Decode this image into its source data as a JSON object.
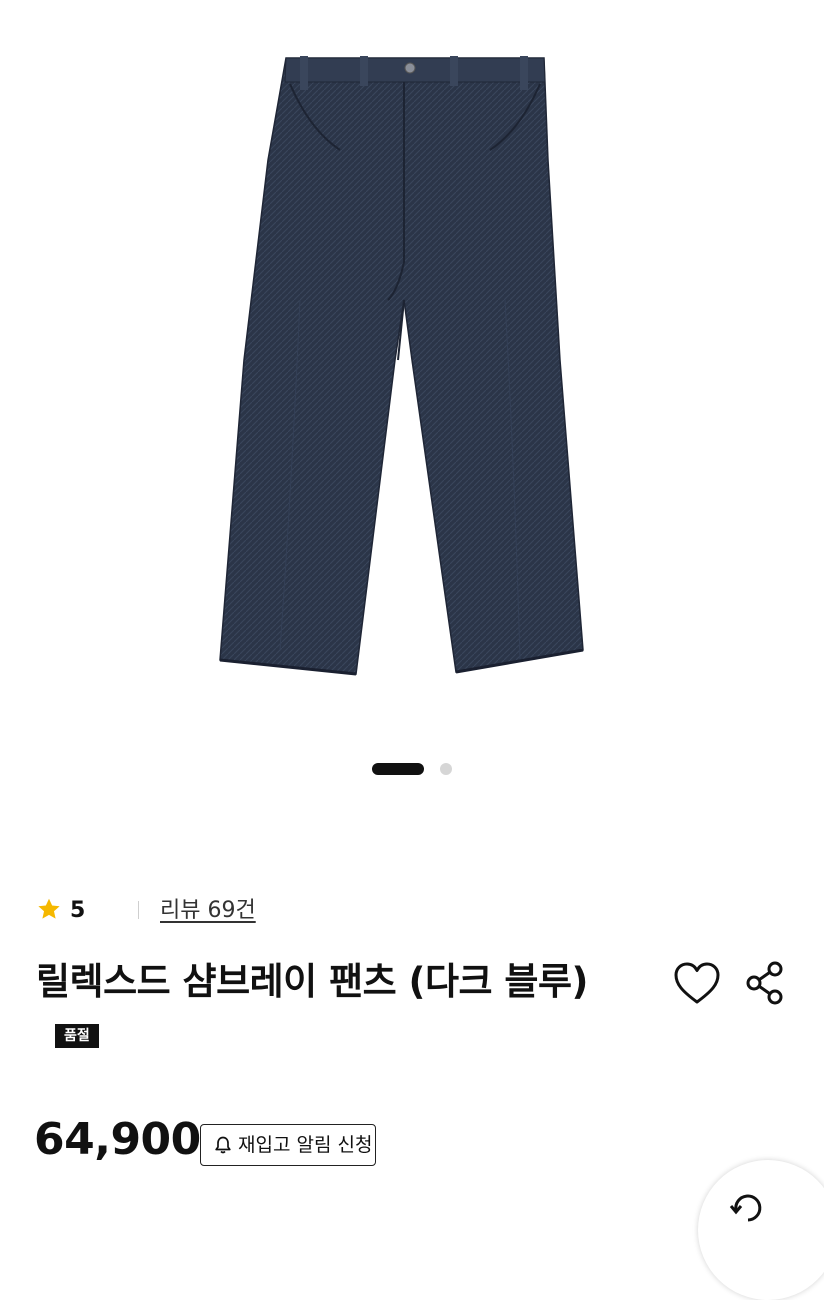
{
  "product": {
    "image_icon": "wide-leg-dark-blue-denim-pants",
    "carousel": {
      "count": 2,
      "active_index": 0
    },
    "rating": {
      "star_icon": "star-icon",
      "star_color": "#F5B800",
      "value": "5"
    },
    "review_link": "리뷰 69건",
    "title": "릴렉스드 샴브레이 팬츠 (다크 블루)",
    "badge": "품절",
    "price": "64,900",
    "restock_button": {
      "icon": "bell-icon",
      "label": "재입고 알림 신청"
    },
    "actions": {
      "like_icon": "heart-icon",
      "share_icon": "share-icon"
    },
    "floating_icon": "refresh-icon"
  },
  "colors": {
    "text": "#111111",
    "denim": "#2B3548",
    "badge_bg": "#111111",
    "dot_inactive": "#D6D6D6"
  }
}
